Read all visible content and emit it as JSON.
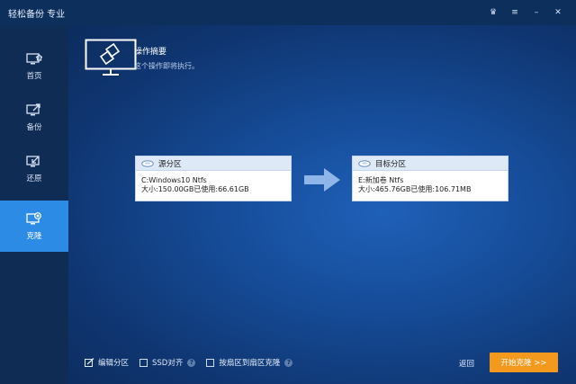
{
  "app": {
    "title": "轻松备份 专业"
  },
  "window_controls": [
    {
      "name": "upgrade-icon",
      "glyph": "♛"
    },
    {
      "name": "menu-icon",
      "glyph": "≡"
    },
    {
      "name": "minimize-icon",
      "glyph": "–"
    },
    {
      "name": "close-icon",
      "glyph": "✕"
    }
  ],
  "sidebar": {
    "items": [
      {
        "label": "首页",
        "icon": "home-icon",
        "active": false
      },
      {
        "label": "备份",
        "icon": "backup-icon",
        "active": false
      },
      {
        "label": "还原",
        "icon": "restore-icon",
        "active": false
      },
      {
        "label": "克隆",
        "icon": "clone-icon",
        "active": true
      }
    ]
  },
  "summary": {
    "title": "操作摘要",
    "subtitle": "这个操作即将执行。"
  },
  "source": {
    "header": "源分区",
    "line1": "C:Windows10 Ntfs",
    "line2": "大小:150.00GB已使用:66.61GB"
  },
  "target": {
    "header": "目标分区",
    "line1": "E:新加卷 Ntfs",
    "line2": "大小:465.76GB已使用:106.71MB"
  },
  "options": {
    "edit_partition": "编辑分区",
    "ssd_align": "SSD对齐",
    "sector_clone": "按扇区到扇区克隆"
  },
  "actions": {
    "back": "返回",
    "start": "开始克隆 >>"
  },
  "colors": {
    "accent": "#2c8be4",
    "start_button": "#f39a1e",
    "sidebar_bg": "#0f2c55"
  }
}
